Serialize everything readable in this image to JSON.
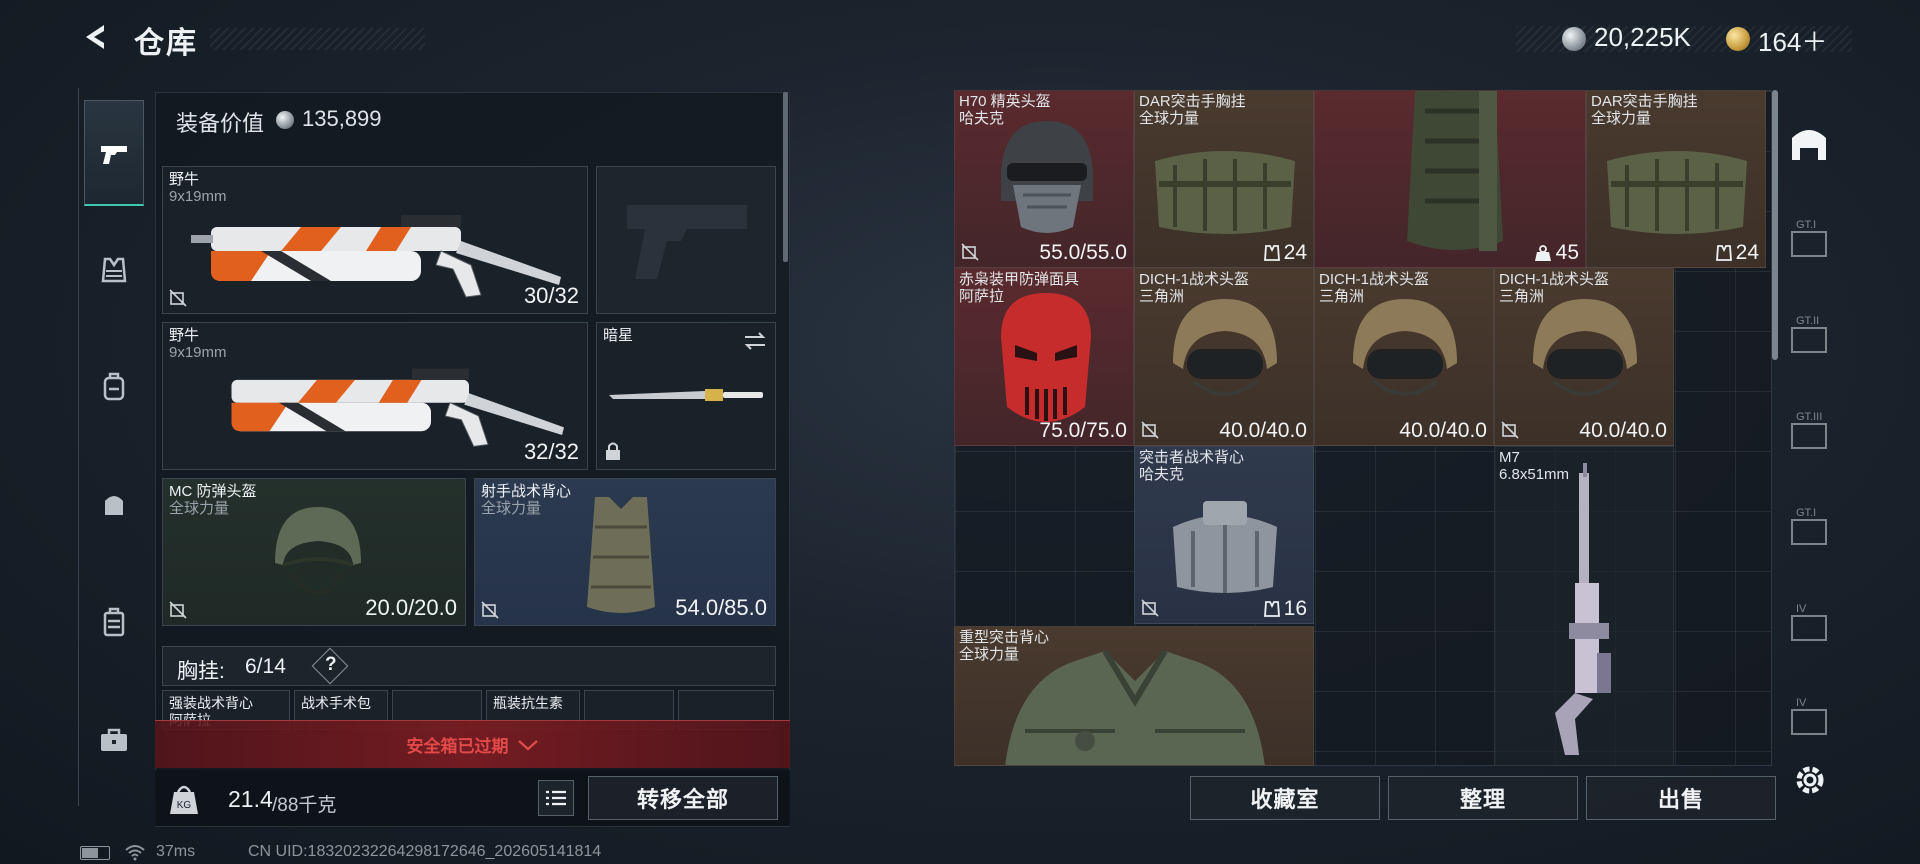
{
  "header": {
    "title": "仓库",
    "silver_amount": "20,225K",
    "gold_amount": "164＋"
  },
  "left_panel": {
    "equip_value_label": "装备价值",
    "equip_value": "135,899",
    "slots": [
      {
        "name": "野牛",
        "sub": "9x19mm",
        "value": "30/32"
      },
      {
        "name": "野牛",
        "sub": "9x19mm",
        "value": "32/32"
      },
      {
        "name": "暗星"
      },
      {
        "name": "MC 防弹头盔",
        "sub": "全球力量",
        "value": "20.0/20.0"
      },
      {
        "name": "射手战术背心",
        "sub": "全球力量",
        "value": "54.0/85.0"
      }
    ],
    "chest_rig_label": "胸挂:",
    "chest_rig_count": "6/14",
    "help_label": "?",
    "small_items": [
      "强装战术背心",
      "阿萨拉",
      "战术手术包",
      "瓶装抗生素"
    ],
    "safe_box_label": "安全箱已过期",
    "weight": "21.4",
    "weight_max": "/88千克",
    "transfer_all_label": "转移全部"
  },
  "grid": [
    {
      "name": "H70 精英头盔",
      "sub": "哈夫克",
      "value": "55.0/55.0",
      "bg": "#5a2a2e"
    },
    {
      "name": "DAR突击手胸挂",
      "sub": "全球力量",
      "count": "24",
      "bg": "#4a3a2e"
    },
    {
      "name": "",
      "count": "45",
      "bg": "#5a2a2e"
    },
    {
      "name": "DAR突击手胸挂",
      "sub": "全球力量",
      "count": "24",
      "bg": "#4a3a2e"
    },
    {
      "name": "赤枭装甲防弹面具",
      "sub": "阿萨拉",
      "value": "75.0/75.0",
      "bg": "#5a2a2e"
    },
    {
      "name": "DICH-1战术头盔",
      "sub": "三角洲",
      "value": "40.0/40.0",
      "bg": "#4a3a2e"
    },
    {
      "name": "DICH-1战术头盔",
      "sub": "三角洲",
      "value": "40.0/40.0",
      "bg": "#4a3a2e"
    },
    {
      "name": "DICH-1战术头盔",
      "sub": "三角洲",
      "value": "40.0/40.0",
      "bg": "#4a3a2e"
    },
    {
      "name": "突击者战术背心",
      "sub": "哈夫克",
      "count": "16",
      "bg": "#2f3a4c"
    },
    {
      "name": "M7",
      "sub": "6.8x51mm",
      "bg": "#1c232b"
    },
    {
      "name": "重型突击背心",
      "sub": "全球力量",
      "bg": "#4a3a2e"
    }
  ],
  "bottom_buttons": {
    "collection": "收藏室",
    "sort": "整理",
    "sell": "出售"
  },
  "status_bar": {
    "ping": "37ms",
    "uid": "CN UID:18320232264298172646_202605141814"
  },
  "side_tabs": [
    "GT.I",
    "GT.II",
    "GT.III",
    "GT.I",
    "IV",
    "IV"
  ],
  "colors": {
    "accent_teal": "#3ec7b1",
    "warning_red": "#e24a4a",
    "red_slot": "#5a2a2e",
    "brown_slot": "#4a3a2e",
    "navy_slot": "#2f3a4c"
  }
}
